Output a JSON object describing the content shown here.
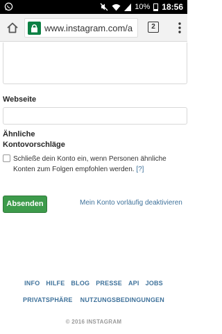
{
  "status_bar": {
    "time": "18:56",
    "battery": "10%",
    "icons": [
      "whatsapp-icon",
      "mute-icon",
      "wifi-icon",
      "signal-icon",
      "battery-icon"
    ]
  },
  "browser": {
    "url": "www.instagram.com/a",
    "tab_count": "2",
    "icons": [
      "home-icon",
      "lock-icon",
      "menu-icon"
    ],
    "secure_color": "#0b8043"
  },
  "form": {
    "website_label": "Webseite",
    "website_value": "",
    "similar_label_line1": "Ähnliche",
    "similar_label_line2": "Kontovorschläge",
    "checkbox_text": "Schließe dein Konto ein, wenn Personen ähnliche Konten zum Folgen empfohlen werden.",
    "checkbox_help": "[?]",
    "checkbox_checked": false,
    "submit_label": "Absenden",
    "deactivate_label": "Mein Konto vorläufig deaktivieren"
  },
  "footer": {
    "links_row1": [
      "INFO",
      "HILFE",
      "BLOG",
      "PRESSE",
      "API",
      "JOBS"
    ],
    "links_row2": [
      "PRIVATSPHÄRE",
      "NUTZUNGSBEDINGUNGEN"
    ],
    "copyright": "© 2016 INSTAGRAM"
  },
  "colors": {
    "accent_link": "#3f729b",
    "submit_button": "#3d9b4b"
  }
}
